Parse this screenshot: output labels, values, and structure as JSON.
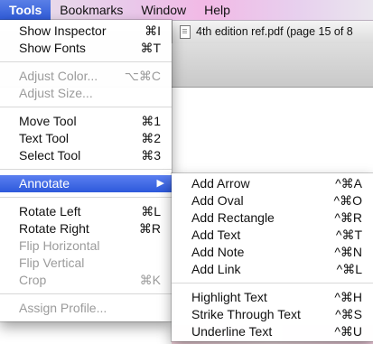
{
  "menubar": {
    "items": [
      "Tools",
      "Bookmarks",
      "Window",
      "Help"
    ]
  },
  "document_tab": {
    "title": "4th edition ref.pdf (page 15 of 8"
  },
  "tools_menu": {
    "items": [
      {
        "label": "Show Inspector",
        "shortcut": "⌘I"
      },
      {
        "label": "Show Fonts",
        "shortcut": "⌘T"
      },
      {
        "label": "Adjust Color...",
        "shortcut": "⌥⌘C"
      },
      {
        "label": "Adjust Size...",
        "shortcut": ""
      },
      {
        "label": "Move Tool",
        "shortcut": "⌘1"
      },
      {
        "label": "Text Tool",
        "shortcut": "⌘2"
      },
      {
        "label": "Select Tool",
        "shortcut": "⌘3"
      },
      {
        "label": "Annotate",
        "shortcut": "▶"
      },
      {
        "label": "Rotate Left",
        "shortcut": "⌘L"
      },
      {
        "label": "Rotate Right",
        "shortcut": "⌘R"
      },
      {
        "label": "Flip Horizontal",
        "shortcut": ""
      },
      {
        "label": "Flip Vertical",
        "shortcut": ""
      },
      {
        "label": "Crop",
        "shortcut": "⌘K"
      },
      {
        "label": "Assign Profile...",
        "shortcut": ""
      }
    ]
  },
  "annotate_menu": {
    "items": [
      {
        "label": "Add Arrow",
        "shortcut": "^⌘A"
      },
      {
        "label": "Add Oval",
        "shortcut": "^⌘O"
      },
      {
        "label": "Add Rectangle",
        "shortcut": "^⌘R"
      },
      {
        "label": "Add Text",
        "shortcut": "^⌘T"
      },
      {
        "label": "Add Note",
        "shortcut": "^⌘N"
      },
      {
        "label": "Add Link",
        "shortcut": "^⌘L"
      },
      {
        "label": "Highlight Text",
        "shortcut": "^⌘H"
      },
      {
        "label": "Strike Through Text",
        "shortcut": "^⌘S"
      },
      {
        "label": "Underline Text",
        "shortcut": "^⌘U"
      }
    ]
  },
  "colors": {
    "highlight": "#2f5bd8",
    "disabled_text": "#9b9b9b"
  }
}
